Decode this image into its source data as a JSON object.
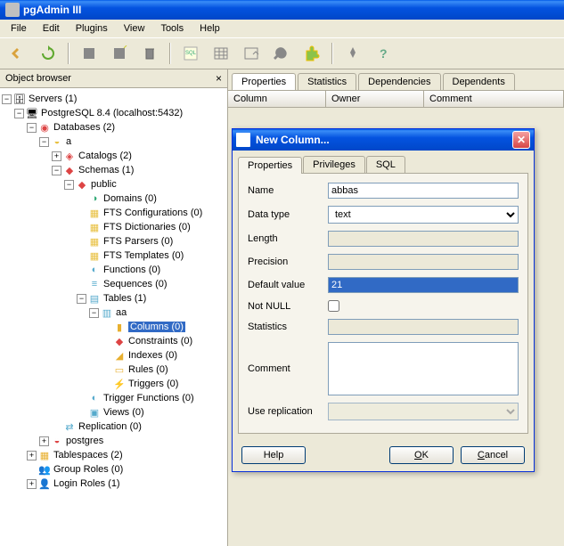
{
  "app_title": "pgAdmin III",
  "menu": [
    "File",
    "Edit",
    "Plugins",
    "View",
    "Tools",
    "Help"
  ],
  "sidebar_title": "Object browser",
  "tree": {
    "servers": "Servers (1)",
    "pg": "PostgreSQL 8.4 (localhost:5432)",
    "databases": "Databases (2)",
    "db_a": "a",
    "catalogs": "Catalogs (2)",
    "schemas": "Schemas (1)",
    "public": "public",
    "domains": "Domains (0)",
    "fts_conf": "FTS Configurations (0)",
    "fts_dict": "FTS Dictionaries (0)",
    "fts_parsers": "FTS Parsers (0)",
    "fts_templates": "FTS Templates (0)",
    "functions": "Functions (0)",
    "sequences": "Sequences (0)",
    "tables": "Tables (1)",
    "table_aa": "aa",
    "columns": "Columns (0)",
    "constraints": "Constraints (0)",
    "indexes": "Indexes (0)",
    "rules": "Rules (0)",
    "triggers": "Triggers (0)",
    "trigger_functions": "Trigger Functions (0)",
    "views": "Views (0)",
    "replication": "Replication (0)",
    "postgres": "postgres",
    "tablespaces": "Tablespaces (2)",
    "group_roles": "Group Roles (0)",
    "login_roles": "Login Roles (1)"
  },
  "content_tabs": [
    "Properties",
    "Statistics",
    "Dependencies",
    "Dependents"
  ],
  "grid_headers": [
    "Column",
    "Owner",
    "Comment"
  ],
  "dialog": {
    "title": "New Column...",
    "tabs": [
      "Properties",
      "Privileges",
      "SQL"
    ],
    "labels": {
      "name": "Name",
      "datatype": "Data type",
      "length": "Length",
      "precision": "Precision",
      "default": "Default value",
      "notnull": "Not NULL",
      "statistics": "Statistics",
      "comment": "Comment",
      "replication": "Use replication"
    },
    "values": {
      "name": "abbas",
      "datatype": "text",
      "default": "21"
    },
    "buttons": {
      "help": "Help",
      "ok": "OK",
      "cancel": "Cancel"
    }
  }
}
